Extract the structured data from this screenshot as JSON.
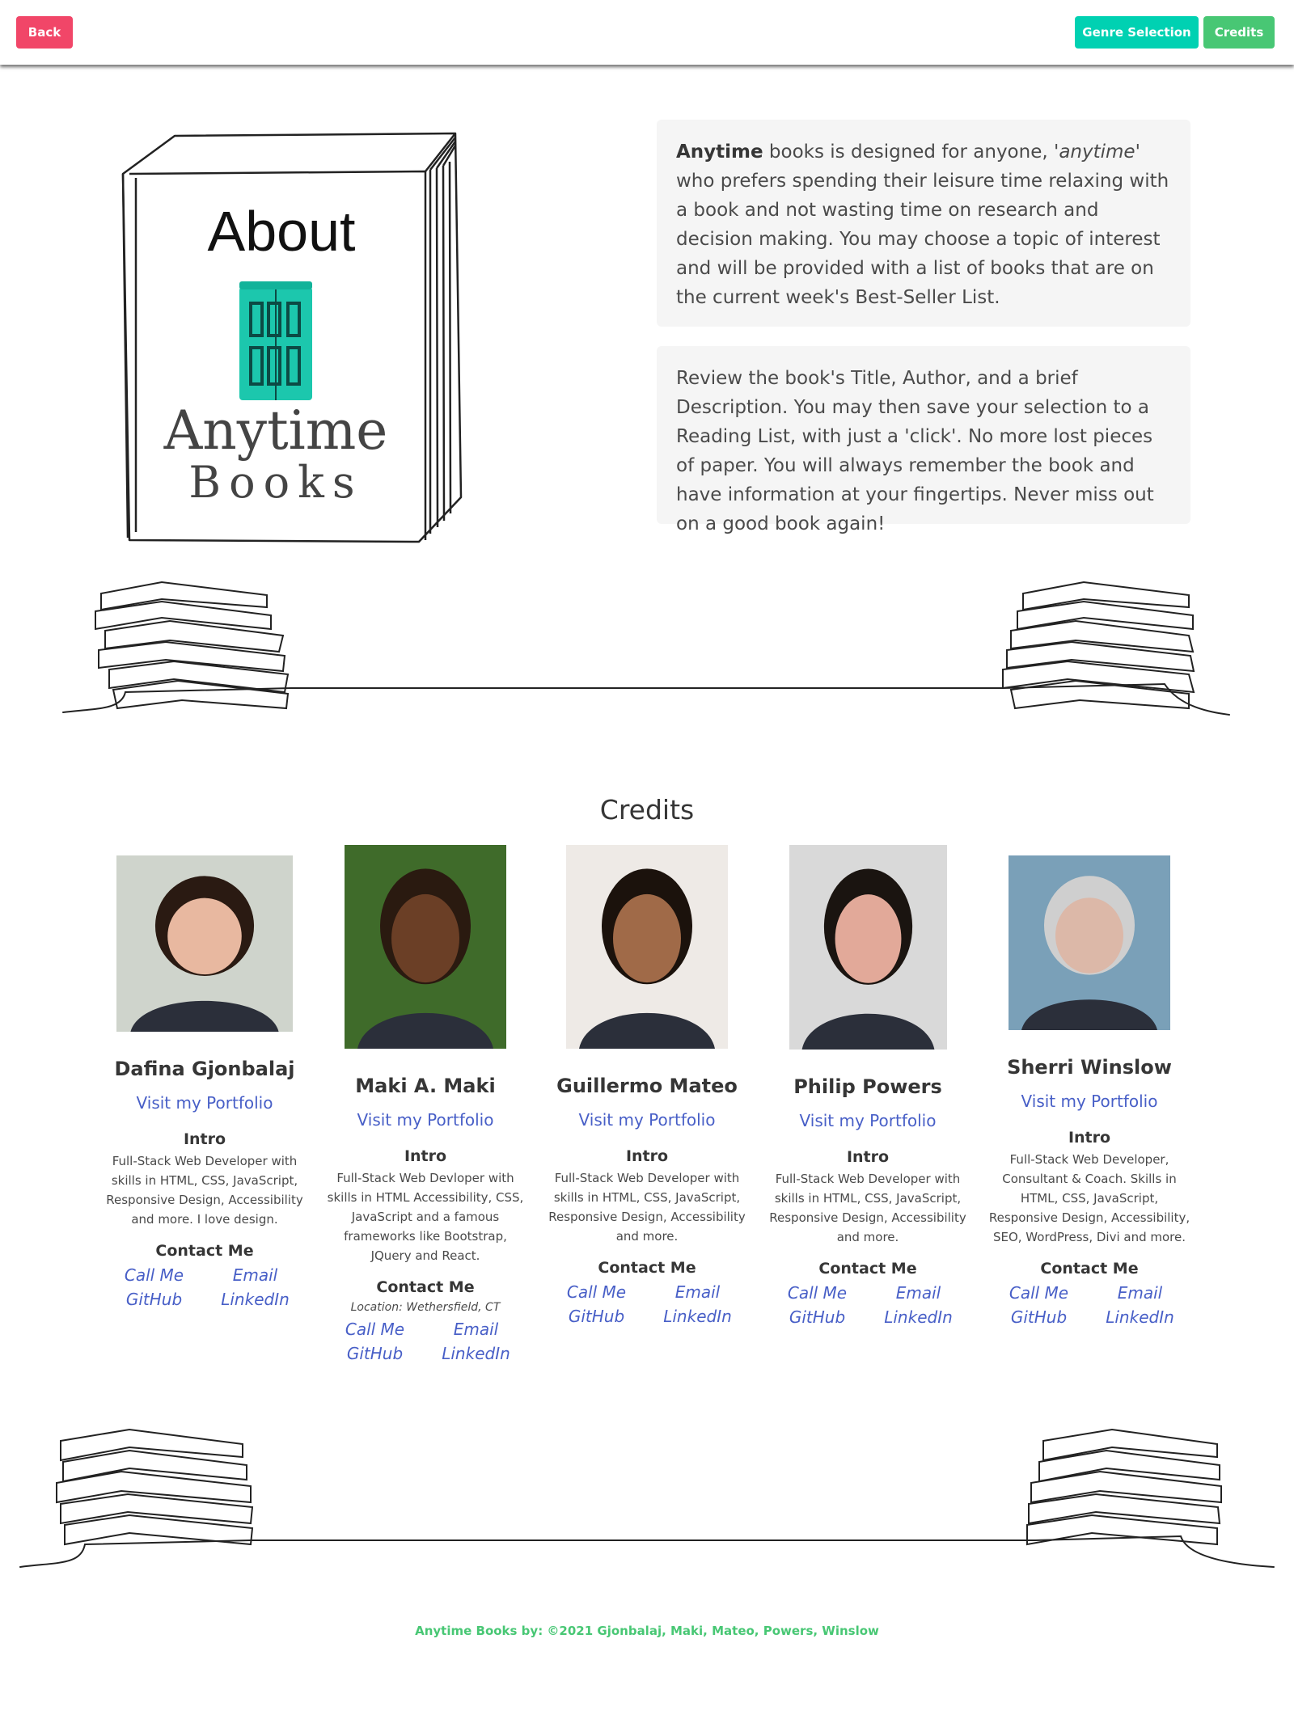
{
  "nav": {
    "back": "Back",
    "genre": "Genre Selection",
    "credits": "Credits"
  },
  "hero": {
    "book_title": "About",
    "book_brand_1": "Anytime",
    "book_brand_2": "Books",
    "about1_strong": "Anytime",
    "about1_a": " books is designed for anyone, '",
    "about1_em": "anytime",
    "about1_b": "' who prefers spending their leisure time relaxing with a book and not wasting time on research and decision making. You may choose a topic of interest and will be provided with a list of books that are on the current week's Best-Seller List.",
    "about2": "Review the book's Title, Author, and a brief Description. You may then save your selection to a Reading List, with just a 'click'. No more lost pieces of paper. You will always remember the book and have information at your fingertips. Never miss out on a good book again!"
  },
  "credits": {
    "title": "Credits",
    "people": [
      {
        "name": "Dafina Gjonbalaj",
        "portfolio": "Visit my Portfolio",
        "intro_h": "Intro",
        "intro": "Full-Stack Web Developer with skills in HTML, CSS, JavaScript, Responsive Design, Accessibility and more. I love design.",
        "contact_h": "Contact Me",
        "location": "",
        "call": "Call Me",
        "email": "Email",
        "github": "GitHub",
        "linkedin": "LinkedIn"
      },
      {
        "name": "Maki A. Maki",
        "portfolio": "Visit my Portfolio",
        "intro_h": "Intro",
        "intro": "Full-Stack Web Devloper with skills in HTML Accessibility, CSS, JavaScript and a famous frameworks like Bootstrap, JQuery and React.",
        "contact_h": "Contact Me",
        "location": "Location: Wethersfield, CT",
        "call": "Call Me",
        "email": "Email",
        "github": "GitHub",
        "linkedin": "LinkedIn"
      },
      {
        "name": "Guillermo Mateo",
        "portfolio": "Visit my Portfolio",
        "intro_h": "Intro",
        "intro": "Full-Stack Web Developer with skills in HTML, CSS, JavaScript, Responsive Design, Accessibility and more.",
        "contact_h": "Contact Me",
        "location": "",
        "call": "Call Me",
        "email": "Email",
        "github": "GitHub",
        "linkedin": "LinkedIn"
      },
      {
        "name": "Philip Powers",
        "portfolio": "Visit my Portfolio",
        "intro_h": "Intro",
        "intro": "Full-Stack Web Developer with skills in HTML, CSS, JavaScript, Responsive Design, Accessibility and more.",
        "contact_h": "Contact Me",
        "location": "",
        "call": "Call Me",
        "email": "Email",
        "github": "GitHub",
        "linkedin": "LinkedIn"
      },
      {
        "name": "Sherri Winslow",
        "portfolio": "Visit my Portfolio",
        "intro_h": "Intro",
        "intro": "Full-Stack Web Developer, Consultant & Coach. Skills in HTML, CSS, JavaScript, Responsive Design, Accessibility, SEO, WordPress, Divi and more.",
        "contact_h": "Contact Me",
        "location": "",
        "call": "Call Me",
        "email": "Email",
        "github": "GitHub",
        "linkedin": "LinkedIn"
      }
    ]
  },
  "footer": "Anytime Books by: ©2021 Gjonbalaj, Maki, Mateo, Powers, Winslow",
  "colors": {
    "danger": "#f14668",
    "primary": "#00d1b2",
    "success": "#48c774",
    "link": "#485fc7",
    "box": "#f5f5f5"
  }
}
